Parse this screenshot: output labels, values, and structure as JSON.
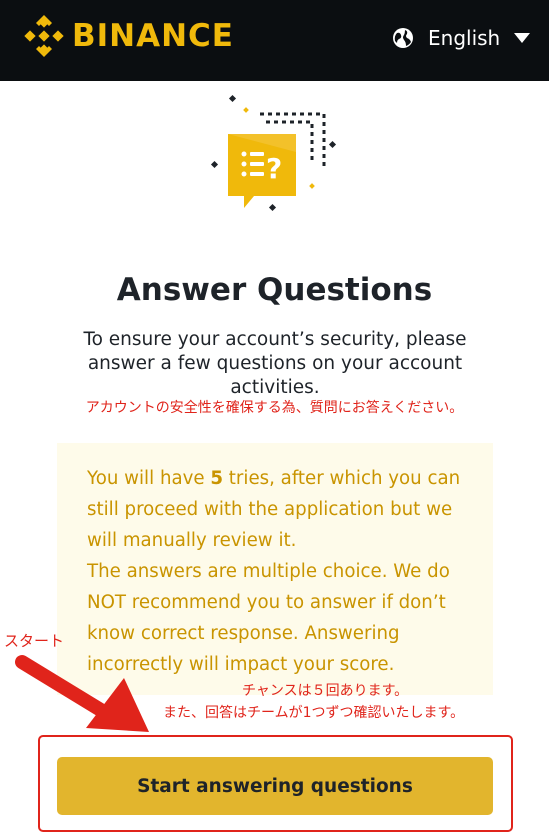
{
  "header": {
    "brand": "BINANCE",
    "language": "English",
    "globe_icon": "globe-icon",
    "caret_icon": "caret-down-icon",
    "brand_color": "#f0b90b",
    "bg_color": "#0b0e11"
  },
  "illustration": {
    "icon": "question-list-icon"
  },
  "main": {
    "title": "Answer Questions",
    "description": "To ensure your account’s security, please answer a few questions on your account activities.",
    "jp_annotation": "アカウントの安全性を確保する為、質問にお答えください。"
  },
  "notice": {
    "line1_prefix": "You will have ",
    "tries": "5",
    "line1_suffix": " tries, after which you can still proceed with the application but we will manually review it.",
    "line2": "The answers are multiple choice. We do NOT recommend you to answer if don’t know correct response. Answering incorrectly will impact your score.",
    "text_color": "#c99400",
    "bg_color": "#fefbea"
  },
  "annotations": {
    "start": "スタート",
    "tries_note": "チャンスは５回あります。",
    "review_note": "また、回答はチームが1つずつ確認いたします。",
    "color": "#e0241b"
  },
  "cta": {
    "label": "Start answering questions",
    "color": "#e2b52d"
  }
}
